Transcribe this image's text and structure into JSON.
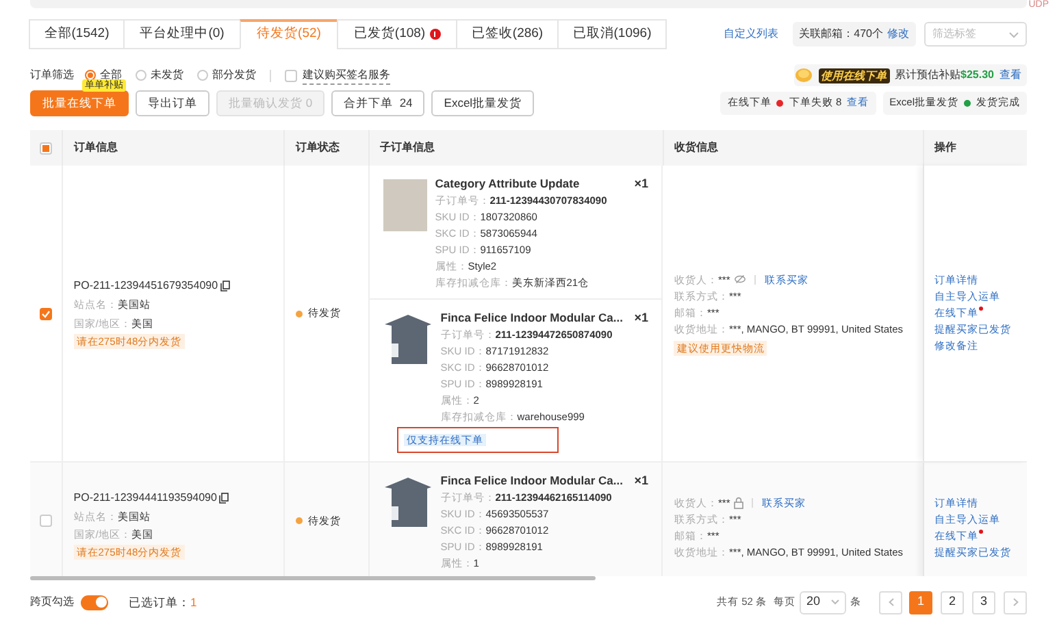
{
  "corner_note": "UDP",
  "tabs": [
    {
      "label": "全部(1542)",
      "selected": false,
      "alert": false
    },
    {
      "label": "平台处理中(0)",
      "selected": false,
      "alert": false
    },
    {
      "label": "待发货(52)",
      "selected": true,
      "alert": false
    },
    {
      "label": "已发货(108)",
      "selected": false,
      "alert": true
    },
    {
      "label": "已签收(286)",
      "selected": false,
      "alert": false
    },
    {
      "label": "已取消(1096)",
      "selected": false,
      "alert": false
    }
  ],
  "header_tools": {
    "custom_list": "自定义列表",
    "email_label": "关联邮箱：470个",
    "email_edit": "修改",
    "tag_select": {
      "placeholder": "筛选标签"
    }
  },
  "filter": {
    "label": "订单筛选",
    "options": [
      {
        "label": "全部",
        "selected": true
      },
      {
        "label": "未发货",
        "selected": false
      },
      {
        "label": "部分发货",
        "selected": false
      }
    ],
    "signature": {
      "label": "建议购买签名服务",
      "checked": false
    }
  },
  "promo": {
    "banner": "使用在线下单",
    "text": "累计预估补贴",
    "amount": "$25.30",
    "link": "查看"
  },
  "actions": [
    {
      "label": "批量在线下单",
      "kind": "primary",
      "badge": "单单补贴"
    },
    {
      "label": "导出订单",
      "kind": "default"
    },
    {
      "label": "批量确认发货 0",
      "kind": "disabled"
    },
    {
      "label": "合并下单  24",
      "kind": "default"
    },
    {
      "label": "Excel批量发货",
      "kind": "default"
    }
  ],
  "status_chips": [
    {
      "label": "在线下单",
      "color": "#e8262a",
      "status": "下单失败 8",
      "link": "查看"
    },
    {
      "label": "Excel批量发货",
      "color": "#22a045",
      "status": "发货完成"
    }
  ],
  "table": {
    "select_all": {
      "indeterminate": true
    },
    "columns": [
      "订单信息",
      "订单状态",
      "子订单信息",
      "收货信息",
      "操作"
    ],
    "rows": [
      {
        "checked": true,
        "order_no": "PO-211-12394451679354090",
        "site_label": "站点名：",
        "site": "美国站",
        "country_label": "国家/地区：",
        "country": "美国",
        "deadline": "请在275时48分内发货",
        "status": "待发货",
        "items": [
          {
            "kind": "photo",
            "title": "Category Attribute Update",
            "qty": "×1",
            "fields": [
              {
                "label": "子订单号：",
                "value": "211-12394430707834090"
              },
              {
                "label": "SKU ID：",
                "value": "1807320860"
              },
              {
                "label": "SKC ID：",
                "value": "5873065944"
              },
              {
                "label": "SPU ID：",
                "value": "911657109"
              },
              {
                "label": "属性：",
                "value": "Style2"
              },
              {
                "label": "库存扣减仓库：",
                "value": "美东新泽西21仓"
              }
            ]
          },
          {
            "kind": "shed",
            "title": "Finca Felice Indoor Modular Ca...",
            "qty": "×1",
            "fields": [
              {
                "label": "子订单号：",
                "value": "211-12394472650874090"
              },
              {
                "label": "SKU ID：",
                "value": "87171912832"
              },
              {
                "label": "SKC ID：",
                "value": "96628701012"
              },
              {
                "label": "SPU ID：",
                "value": "8989928191"
              },
              {
                "label": "属性：",
                "value": "2"
              },
              {
                "label": "库存扣减仓库：",
                "value": "warehouse999"
              }
            ],
            "tag": "仅支持在线下单",
            "highlighted": true
          }
        ],
        "receiver": {
          "kind": "hidden",
          "name_label": "收货人：",
          "name": "***",
          "contact_link": "联系买家",
          "phone_label": "联系方式：",
          "phone": "***",
          "email_label": "邮箱：",
          "email": "***",
          "address_label": "收货地址：",
          "address": "***, MANGO, BT 99991, United States",
          "tip": "建议使用更快物流"
        },
        "ops": [
          {
            "label": "订单详情",
            "dot": false
          },
          {
            "label": "自主导入运单",
            "dot": false
          },
          {
            "label": "在线下单",
            "dot": true
          },
          {
            "label": "提醒买家已发货",
            "dot": false
          },
          {
            "label": "修改备注",
            "dot": false
          }
        ]
      },
      {
        "checked": false,
        "order_no": "PO-211-12394441193594090",
        "site_label": "站点名：",
        "site": "美国站",
        "country_label": "国家/地区：",
        "country": "美国",
        "deadline": "请在275时48分内发货",
        "status": "待发货",
        "items": [
          {
            "kind": "shed",
            "title": "Finca Felice Indoor Modular Ca...",
            "qty": "×1",
            "fields": [
              {
                "label": "子订单号：",
                "value": "211-12394462165114090"
              },
              {
                "label": "SKU ID：",
                "value": "45693505537"
              },
              {
                "label": "SKC ID：",
                "value": "96628701012"
              },
              {
                "label": "SPU ID：",
                "value": "8989928191"
              },
              {
                "label": "属性：",
                "value": "1"
              }
            ]
          }
        ],
        "receiver": {
          "kind": "locked",
          "name_label": "收货人：",
          "name": "***",
          "contact_link": "联系买家",
          "phone_label": "联系方式：",
          "phone": "***",
          "email_label": "邮箱：",
          "email": "***",
          "address_label": "收货地址：",
          "address": "***, MANGO, BT 99991, United States"
        },
        "ops": [
          {
            "label": "订单详情",
            "dot": false
          },
          {
            "label": "自主导入运单",
            "dot": false
          },
          {
            "label": "在线下单",
            "dot": true
          },
          {
            "label": "提醒买家已发货",
            "dot": false
          }
        ]
      }
    ]
  },
  "footer": {
    "cross_page_label": "跨页勾选",
    "cross_page_on": true,
    "selected_label": "已选订单：",
    "selected_count": "1",
    "total": "共有 52 条",
    "per_page_label": "每页",
    "page_size": "20",
    "unit": "条",
    "pages": [
      {
        "label": "1",
        "selected": true
      },
      {
        "label": "2",
        "selected": false
      },
      {
        "label": "3",
        "selected": false
      }
    ]
  }
}
